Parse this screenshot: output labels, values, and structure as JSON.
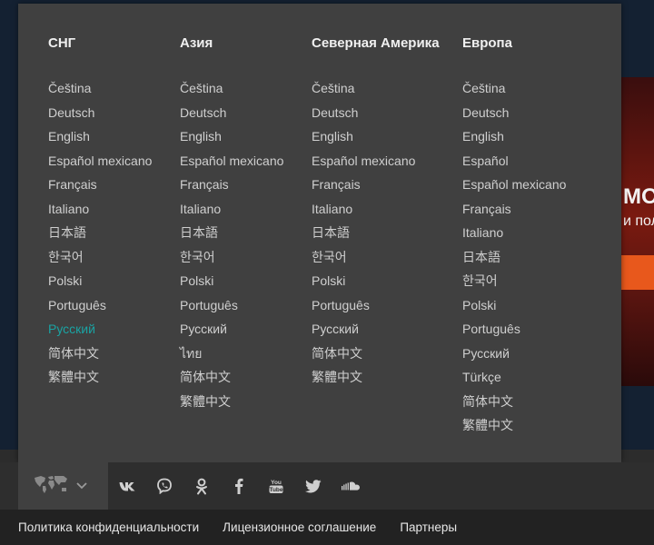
{
  "background": {
    "banner_line1": "МОР",
    "banner_line2": "и пол"
  },
  "regions": [
    {
      "title": "СНГ",
      "languages": [
        "Čeština",
        "Deutsch",
        "English",
        "Español mexicano",
        "Français",
        "Italiano",
        "日本語",
        "한국어",
        "Polski",
        "Português",
        "Русский",
        "简体中文",
        "繁體中文"
      ],
      "active": "Русский"
    },
    {
      "title": "Азия",
      "languages": [
        "Čeština",
        "Deutsch",
        "English",
        "Español mexicano",
        "Français",
        "Italiano",
        "日本語",
        "한국어",
        "Polski",
        "Português",
        "Русский",
        "ไทย",
        "简体中文",
        "繁體中文"
      ]
    },
    {
      "title": "Северная Америка",
      "languages": [
        "Čeština",
        "Deutsch",
        "English",
        "Español mexicano",
        "Français",
        "Italiano",
        "日本語",
        "한국어",
        "Polski",
        "Português",
        "Русский",
        "简体中文",
        "繁體中文"
      ]
    },
    {
      "title": "Европа",
      "languages": [
        "Čeština",
        "Deutsch",
        "English",
        "Español",
        "Español mexicano",
        "Français",
        "Italiano",
        "日本語",
        "한국어",
        "Polski",
        "Português",
        "Русский",
        "Türkçe",
        "简体中文",
        "繁體中文"
      ]
    }
  ],
  "footer": {
    "region_icon": "world-map-icon",
    "social_icons": [
      "vk-icon",
      "viber-icon",
      "odnoklassniki-icon",
      "facebook-icon",
      "youtube-icon",
      "twitter-icon",
      "soundcloud-icon"
    ],
    "links": [
      "Политика конфиденциальности",
      "Лицензионное соглашение",
      "Партнеры"
    ]
  },
  "colors": {
    "active_language": "#1aa3a3",
    "menu_bg": "#404040"
  }
}
